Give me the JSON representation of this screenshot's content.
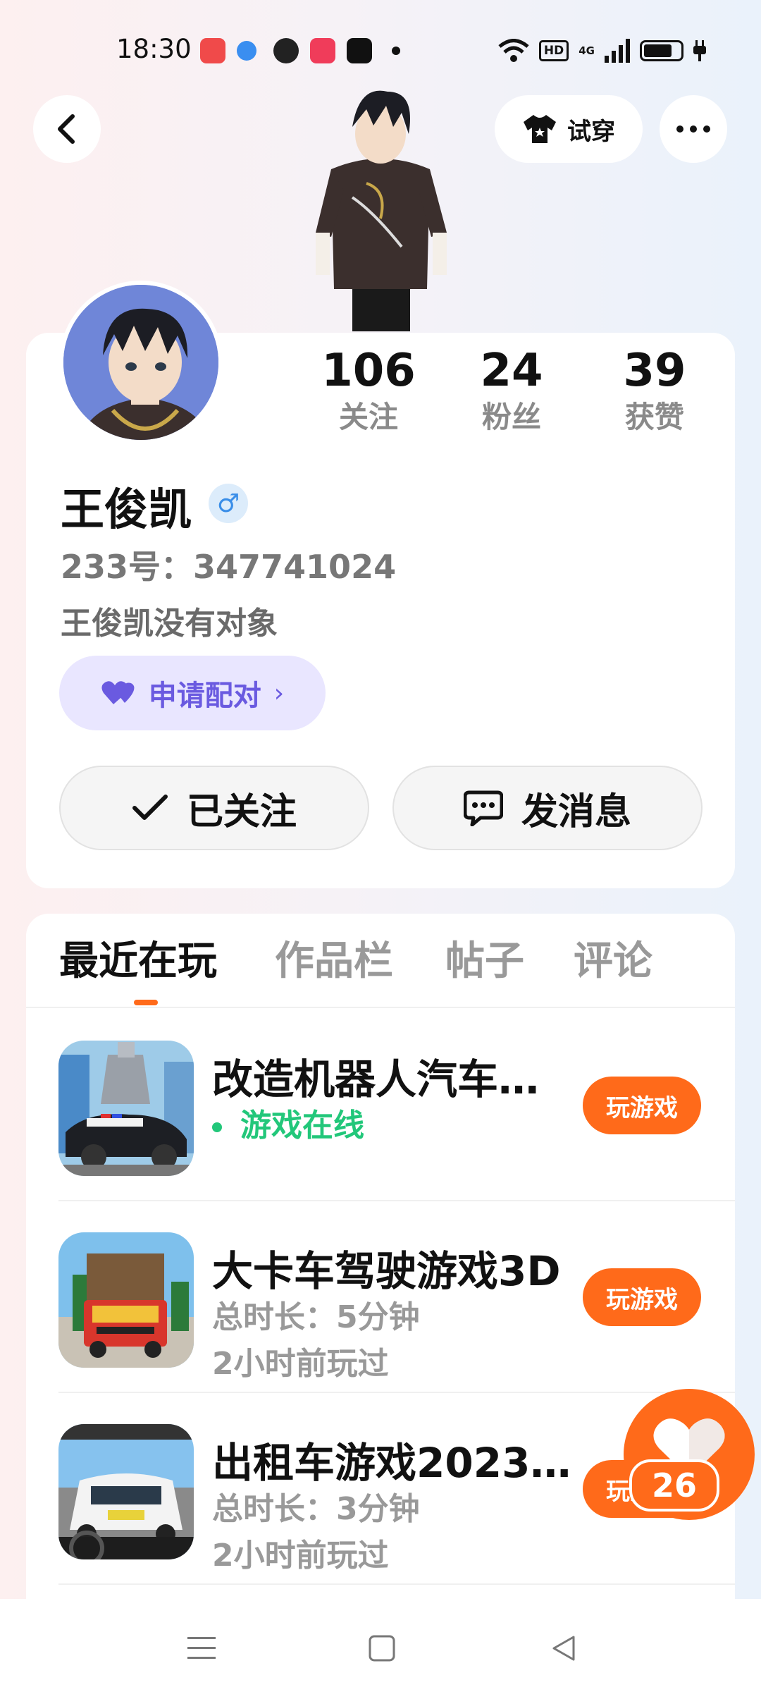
{
  "status_bar": {
    "time": "18:30",
    "network": "4G",
    "hd_label": "HD"
  },
  "header": {
    "tryon_label": "试穿"
  },
  "profile": {
    "stats": [
      {
        "value": "106",
        "label": "关注"
      },
      {
        "value": "24",
        "label": "粉丝"
      },
      {
        "value": "39",
        "label": "获赞"
      }
    ],
    "name": "王俊凯",
    "gender_symbol": "♂",
    "uid": "233号：347741024",
    "bio": "王俊凯没有对象",
    "pair_label": "申请配对",
    "follow_label": "已关注",
    "message_label": "发消息"
  },
  "tabs": [
    {
      "label": "最近在玩",
      "active": true
    },
    {
      "label": "作品栏",
      "active": false
    },
    {
      "label": "帖子",
      "active": false
    },
    {
      "label": "评论",
      "active": false
    }
  ],
  "games": [
    {
      "title": "改造机器人汽车…",
      "status": "游戏在线",
      "line2": "",
      "button": "玩游戏"
    },
    {
      "title": "大卡车驾驶游戏3D",
      "status": "",
      "line1": "总时长：5分钟",
      "line2": "2小时前玩过",
      "button": "玩游戏"
    },
    {
      "title": "出租车游戏2023…",
      "status": "",
      "line1": "总时长：3分钟",
      "line2": "2小时前玩过",
      "button": "玩游戏"
    }
  ],
  "like_fab": {
    "count": "26"
  },
  "colors": {
    "accent": "#ff6a1a",
    "online": "#22c77a",
    "pair": "#6a5ae0"
  }
}
